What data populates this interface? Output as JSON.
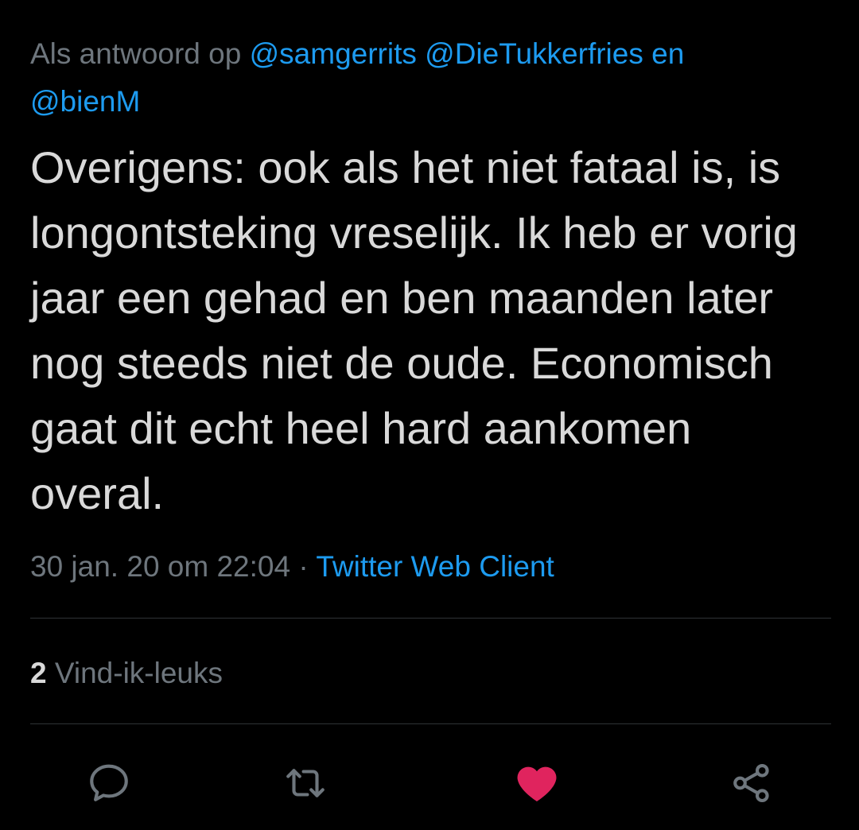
{
  "reply": {
    "prefix": "Als antwoord op",
    "mention_1": "@samgerrits",
    "mention_2": "@DieTukkerfries",
    "conjunction": "en",
    "mention_3": "@bienM"
  },
  "tweet": {
    "text": "Overigens: ook als het niet fataal is, is longontsteking vreselijk. Ik heb er vorig jaar een gehad en ben maanden later nog steeds niet de oude. Economisch gaat dit echt heel hard aankomen overal."
  },
  "meta": {
    "timestamp": "30 jan. 20 om 22:04",
    "separator": "·",
    "client": "Twitter Web Client"
  },
  "likes": {
    "count": "2",
    "label": "Vind-ik-leuks"
  },
  "actions": {
    "reply_icon": "reply-icon",
    "retweet_icon": "retweet-icon",
    "like_icon": "heart-icon",
    "share_icon": "share-icon",
    "like_color": "#e0245e",
    "icon_color": "#6e767d",
    "liked": true
  }
}
